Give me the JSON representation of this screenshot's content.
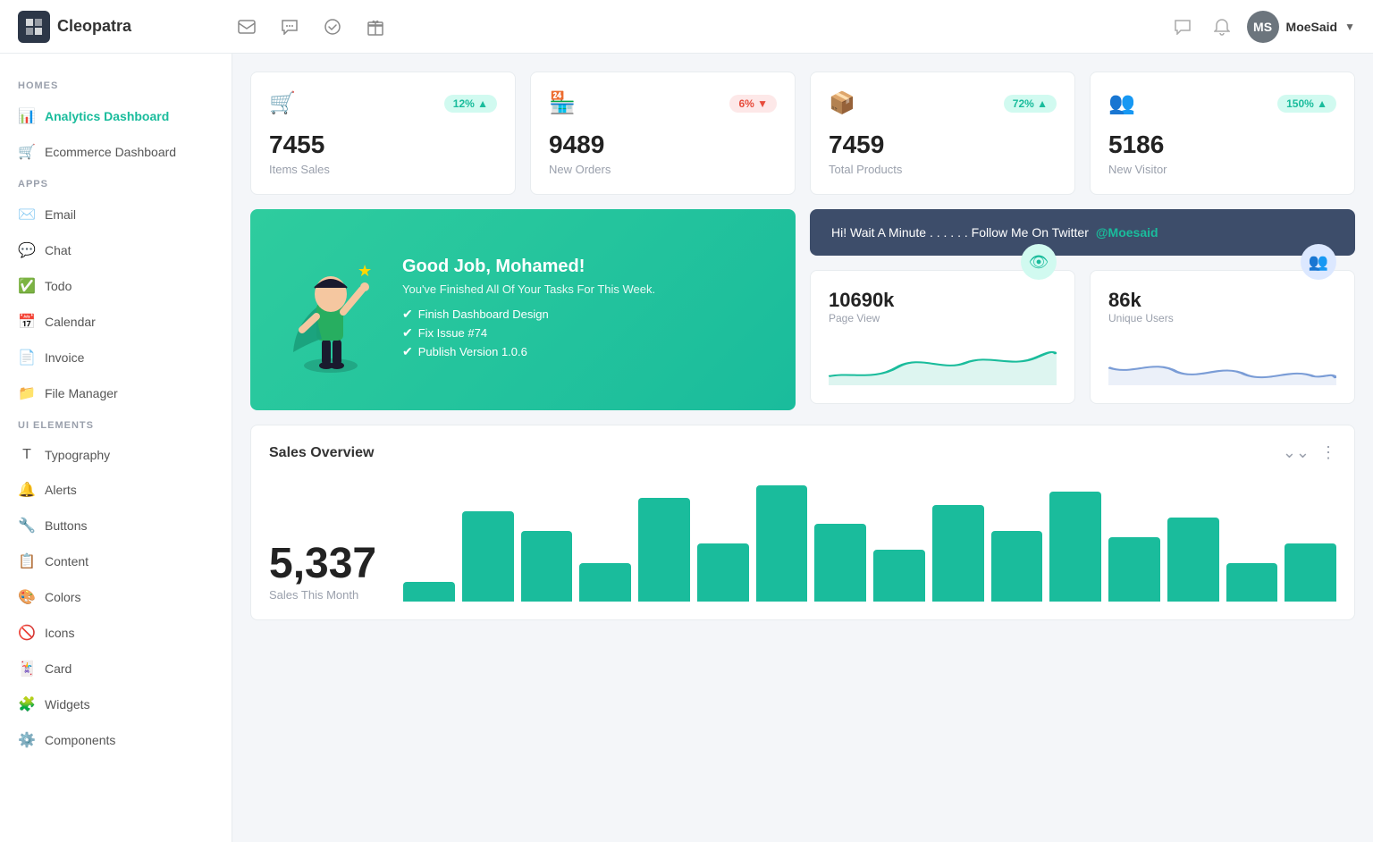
{
  "app": {
    "name": "Cleopatra"
  },
  "topnav": {
    "icons": [
      "✉",
      "💬",
      "✔",
      "🎁"
    ],
    "right_icons": [
      "💬",
      "🔔"
    ],
    "user": {
      "name": "MoeSaid",
      "initials": "MS"
    }
  },
  "sidebar": {
    "sections": [
      {
        "title": "HOMES",
        "items": [
          {
            "id": "analytics-dashboard",
            "label": "Analytics Dashboard",
            "icon": "📊",
            "active": true
          },
          {
            "id": "ecommerce-dashboard",
            "label": "Ecommerce Dashboard",
            "icon": "🛒",
            "active": false
          }
        ]
      },
      {
        "title": "APPS",
        "items": [
          {
            "id": "email",
            "label": "Email",
            "icon": "✉️",
            "active": false
          },
          {
            "id": "chat",
            "label": "Chat",
            "icon": "💬",
            "active": false
          },
          {
            "id": "todo",
            "label": "Todo",
            "icon": "✅",
            "active": false
          },
          {
            "id": "calendar",
            "label": "Calendar",
            "icon": "📅",
            "active": false
          },
          {
            "id": "invoice",
            "label": "Invoice",
            "icon": "📄",
            "active": false
          },
          {
            "id": "file-manager",
            "label": "File Manager",
            "icon": "📁",
            "active": false
          }
        ]
      },
      {
        "title": "UI ELEMENTS",
        "items": [
          {
            "id": "typography",
            "label": "Typography",
            "icon": "T",
            "active": false
          },
          {
            "id": "alerts",
            "label": "Alerts",
            "icon": "🔔",
            "active": false
          },
          {
            "id": "buttons",
            "label": "Buttons",
            "icon": "🔧",
            "active": false
          },
          {
            "id": "content",
            "label": "Content",
            "icon": "📋",
            "active": false
          },
          {
            "id": "colors",
            "label": "Colors",
            "icon": "🎨",
            "active": false
          },
          {
            "id": "icons",
            "label": "Icons",
            "icon": "🚫",
            "active": false
          },
          {
            "id": "card",
            "label": "Card",
            "icon": "🃏",
            "active": false
          },
          {
            "id": "widgets",
            "label": "Widgets",
            "icon": "🧩",
            "active": false
          },
          {
            "id": "components",
            "label": "Components",
            "icon": "⚙️",
            "active": false
          }
        ]
      }
    ]
  },
  "stats": [
    {
      "id": "items-sales",
      "icon": "🛒",
      "icon_color": "#6c8fcf",
      "value": "7455",
      "label": "Items Sales",
      "badge": "12%",
      "badge_dir": "up"
    },
    {
      "id": "new-orders",
      "icon": "🏪",
      "icon_color": "#e74c3c",
      "value": "9489",
      "label": "New Orders",
      "badge": "6%",
      "badge_dir": "down"
    },
    {
      "id": "total-products",
      "icon": "📦",
      "icon_color": "#f39c12",
      "value": "7459",
      "label": "Total Products",
      "badge": "72%",
      "badge_dir": "up"
    },
    {
      "id": "new-visitor",
      "icon": "👥",
      "icon_color": "#2ecc71",
      "value": "5186",
      "label": "New Visitor",
      "badge": "150%",
      "badge_dir": "up"
    }
  ],
  "hero": {
    "title": "Good Job, Mohamed!",
    "subtitle": "You've Finished All Of Your Tasks For This Week.",
    "checklist": [
      "Finish Dashboard Design",
      "Fix Issue #74",
      "Publish Version 1.0.6"
    ]
  },
  "twitter_banner": {
    "text": "Hi! Wait A Minute . . . . . . Follow Me On Twitter",
    "handle": "@Moesaid"
  },
  "metrics": [
    {
      "id": "page-view",
      "value": "10690k",
      "label": "Page View",
      "icon": "👁",
      "style": "teal"
    },
    {
      "id": "unique-users",
      "value": "86k",
      "label": "Unique Users",
      "icon": "👥",
      "style": "blue"
    }
  ],
  "sales_overview": {
    "title": "Sales Overview",
    "total": "5,337",
    "label": "Sales This Month",
    "bars": [
      15,
      70,
      55,
      30,
      80,
      45,
      90,
      60,
      40,
      75,
      55,
      85,
      50,
      65,
      30,
      45
    ]
  }
}
